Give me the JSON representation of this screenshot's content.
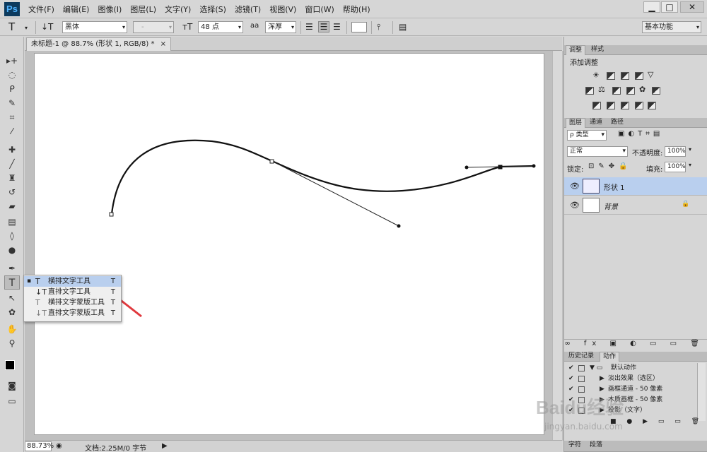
{
  "app": {
    "logo": "Ps"
  },
  "menu": [
    "文件(F)",
    "编辑(E)",
    "图像(I)",
    "图层(L)",
    "文字(Y)",
    "选择(S)",
    "滤镜(T)",
    "视图(V)",
    "窗口(W)",
    "帮助(H)"
  ],
  "options": {
    "font_family": "黑体",
    "font_style": "-",
    "font_size": "48 点",
    "antialias_icon": "aa",
    "antialias": "浑厚",
    "workspace": "基本功能"
  },
  "document": {
    "tab_title": "未标题-1 @ 88.7% (形状 1, RGB/8) *"
  },
  "status": {
    "zoom": "88.73%",
    "doc_info": "文档:2.25M/0 字节"
  },
  "flyout": {
    "items": [
      {
        "label": "横排文字工具",
        "key": "T",
        "selected": true
      },
      {
        "label": "直排文字工具",
        "key": "T",
        "selected": false
      },
      {
        "label": "横排文字蒙版工具",
        "key": "T",
        "selected": false
      },
      {
        "label": "直排文字蒙版工具",
        "key": "T",
        "selected": false
      }
    ]
  },
  "adjustments": {
    "tabs": [
      "调整",
      "样式"
    ],
    "heading": "添加调整"
  },
  "layers": {
    "tabs": [
      "图层",
      "通道",
      "路径"
    ],
    "filter": "类型",
    "blend_mode": "正常",
    "opacity_label": "不透明度:",
    "opacity": "100%",
    "lock_label": "锁定:",
    "fill_label": "填充:",
    "fill": "100%",
    "rows": [
      {
        "name": "形状 1",
        "selected": true
      },
      {
        "name": "背景",
        "selected": false,
        "locked": true
      }
    ]
  },
  "history": {
    "tabs": [
      "历史记录",
      "动作"
    ],
    "actions": [
      "默认动作",
      "淡出效果（选区）",
      "画框通道 - 50 像素",
      "木质画框 - 50 像素",
      "投影（文字）"
    ]
  },
  "bottom_tabs": [
    "字符",
    "段落"
  ],
  "watermark": {
    "line1": "Baidu经验",
    "line2": "jingyan.baidu.com"
  },
  "colors": {
    "accent_selection": "#b9cfee",
    "arrow": "#e0393e",
    "background": "#d6d6d6"
  }
}
